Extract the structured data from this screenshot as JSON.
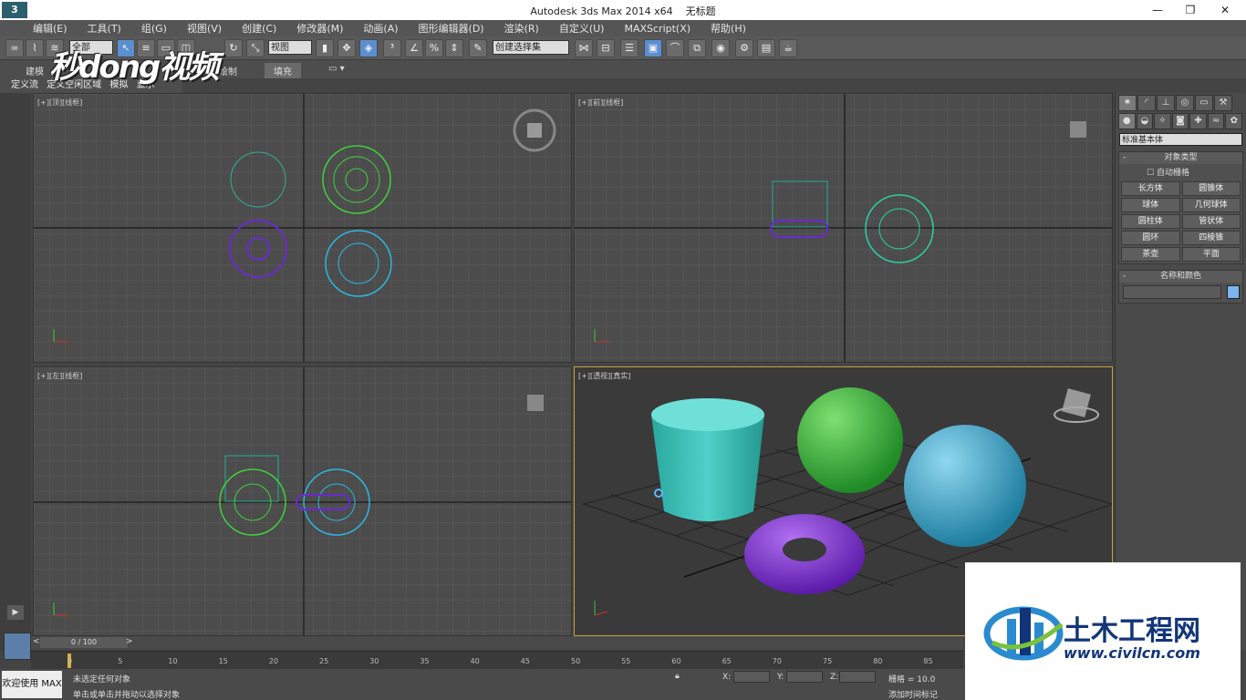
{
  "app": {
    "title": "Autodesk 3ds Max  2014 x64",
    "doc": "无标题",
    "logo": "3"
  },
  "menu": [
    "编辑(E)",
    "工具(T)",
    "组(G)",
    "视图(V)",
    "创建(C)",
    "修改器(M)",
    "动画(A)",
    "图形编辑器(D)",
    "渲染(R)",
    "自定义(U)",
    "MAXScript(X)",
    "帮助(H)"
  ],
  "toolbar": {
    "filter": "全部",
    "refcoord": "视图",
    "selset": "创建选择集"
  },
  "ribbon": {
    "tabs": [
      "建模",
      "",
      "绘制",
      "填充"
    ]
  },
  "subribbon": [
    "定义流",
    "定义空闲区域",
    "模拟",
    "显示"
  ],
  "watermark": "秒dong视频",
  "viewports": [
    {
      "label": "[+][顶][线框]"
    },
    {
      "label": "[+][前][线框]"
    },
    {
      "label": "[+][左][线框]"
    },
    {
      "label": "[+][透视][真实]"
    }
  ],
  "cmdpanel": {
    "category": "标准基本体",
    "rollout1": "对象类型",
    "autogrid": "自动栅格",
    "buttons": [
      "长方体",
      "圆锥体",
      "球体",
      "几何球体",
      "圆柱体",
      "管状体",
      "圆环",
      "四棱锥",
      "茶壶",
      "平面"
    ],
    "rollout2": "名称和颜色",
    "color": "#7bb4f0"
  },
  "timeline": {
    "frame": "0 / 100",
    "ticks": [
      "0",
      "5",
      "10",
      "15",
      "20",
      "25",
      "30",
      "35",
      "40",
      "45",
      "50",
      "55",
      "60",
      "65",
      "70",
      "75",
      "80",
      "85"
    ]
  },
  "status": {
    "welcome": "欢迎使用 MAX",
    "msg1": "未选定任何对象",
    "msg2": "单击或单击并拖动以选择对象",
    "x": "X:",
    "y": "Y:",
    "z": "Z:",
    "grid": "栅格 = 10.0",
    "addkey": "添加时间标记"
  },
  "ad": {
    "title": "土木工程网",
    "url": "www.civilcn.com"
  }
}
